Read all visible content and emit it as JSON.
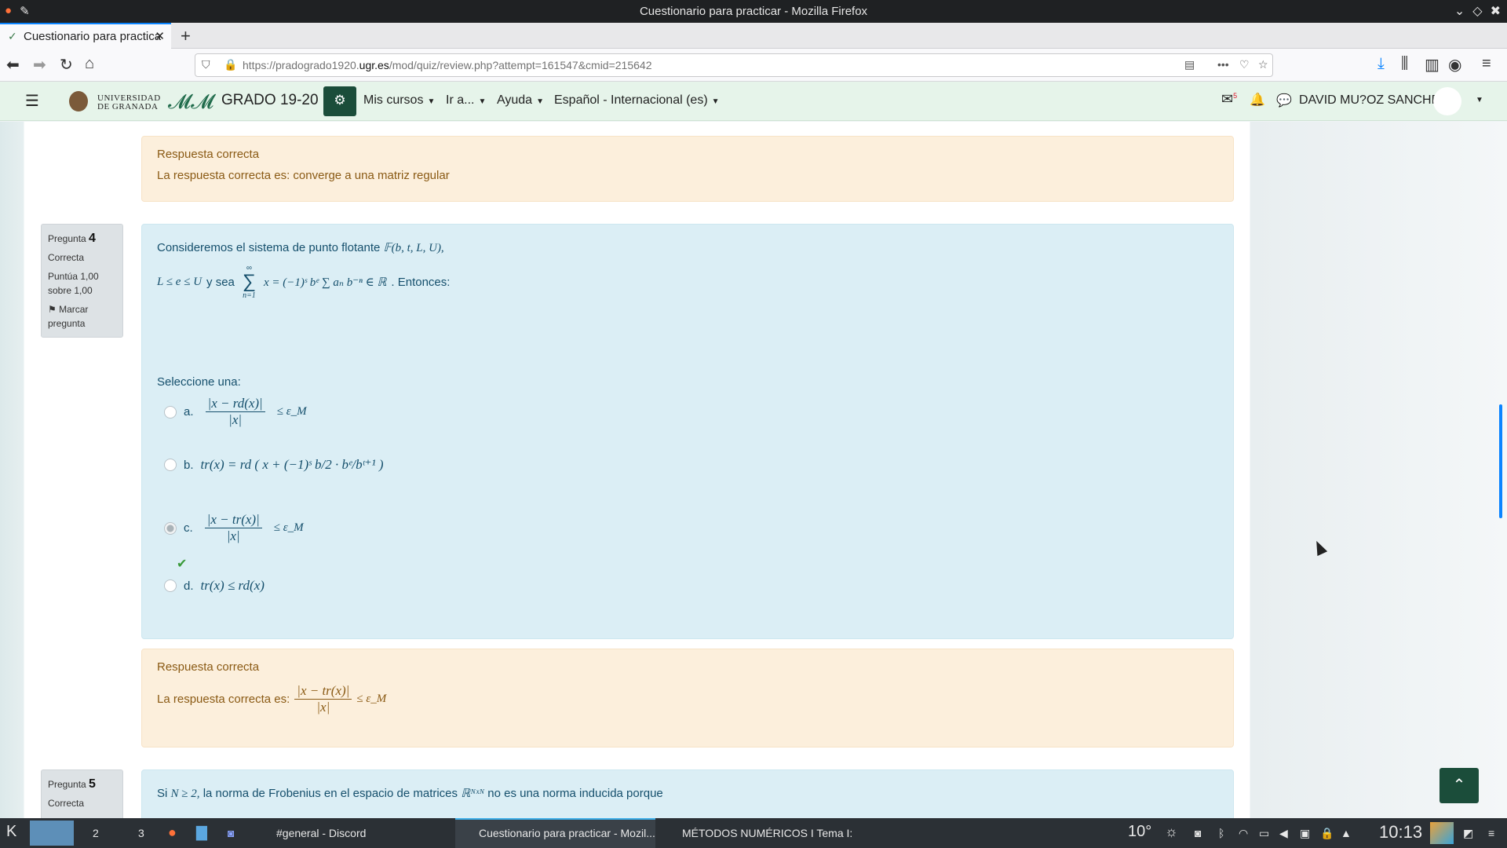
{
  "window": {
    "title": "Cuestionario para practicar - Mozilla Firefox"
  },
  "browser": {
    "tab_title": "Cuestionario para practica",
    "url_prefix": "https://pradogrado1920.",
    "url_domain": "ugr.es",
    "url_path": "/mod/quiz/review.php?attempt=161547&cmid=215642"
  },
  "moodle": {
    "university": [
      "UNIVERSIDAD",
      "DE GRANADA"
    ],
    "site_name": "GRADO 19-20",
    "menu": [
      "Mis cursos",
      "Ir a...",
      "Ayuda",
      "Español - Internacional (es)"
    ],
    "message_count": "5",
    "user_name": "DAVID MU?OZ SANCHEZ"
  },
  "prev_feedback": {
    "title": "Respuesta correcta",
    "text": "La respuesta correcta es: converge a una matriz regular"
  },
  "question4": {
    "label": "Pregunta",
    "number": "4",
    "status": "Correcta",
    "score": "Puntúa 1,00 sobre 1,00",
    "flag": "Marcar pregunta",
    "text1": "Consideremos el sistema de punto flotante",
    "math1": "𝔽(b, t, L, U),",
    "math2a": "L ≤ e ≤ U",
    "text2": "y sea",
    "math2b": "x = (−1)ˢ bᵉ ∑ aₙ b⁻ⁿ ∈ ℝ",
    "sum_top": "∞",
    "sum_bottom": "n=1",
    "text3": ". Entonces:",
    "prompt": "Seleccione una:",
    "options": [
      {
        "letter": "a.",
        "num": "|x − rd(x)|",
        "den": "|x|",
        "rest": "≤ ε_M"
      },
      {
        "letter": "b.",
        "expr": "tr(x) = rd ( x + (−1)ˢ b/2 · bᵉ/bᵗ⁺¹ )"
      },
      {
        "letter": "c.",
        "num": "|x − tr(x)|",
        "den": "|x|",
        "rest": "≤ ε_M"
      },
      {
        "letter": "d.",
        "expr": "tr(x) ≤ rd(x)"
      }
    ],
    "check_icon": "✔"
  },
  "q4_feedback": {
    "title": "Respuesta correcta",
    "text": "La respuesta correcta es:",
    "num": "|x − tr(x)|",
    "den": "|x|",
    "rest": "≤ ε_M"
  },
  "question5": {
    "label": "Pregunta",
    "number": "5",
    "status": "Correcta",
    "text_a": "Si",
    "math_a": "N ≥ 2,",
    "text_b": "la norma de Frobenius en el espacio de matrices",
    "math_b": "ℝᴺˣᴺ",
    "text_c": "no es una norma inducida porque"
  },
  "taskbar": {
    "desktops": [
      "2",
      "3"
    ],
    "apps": [
      "#general - Discord",
      "Cuestionario para practicar - Mozil...",
      "MÉTODOS NUMÉRICOS I   Tema I: ..."
    ],
    "temperature": "10°",
    "clock": "10:13"
  },
  "colors": {
    "moodle_green": "#1b4d3a",
    "question_bg": "#dbeef5",
    "feedback_bg": "#fcefdc"
  }
}
